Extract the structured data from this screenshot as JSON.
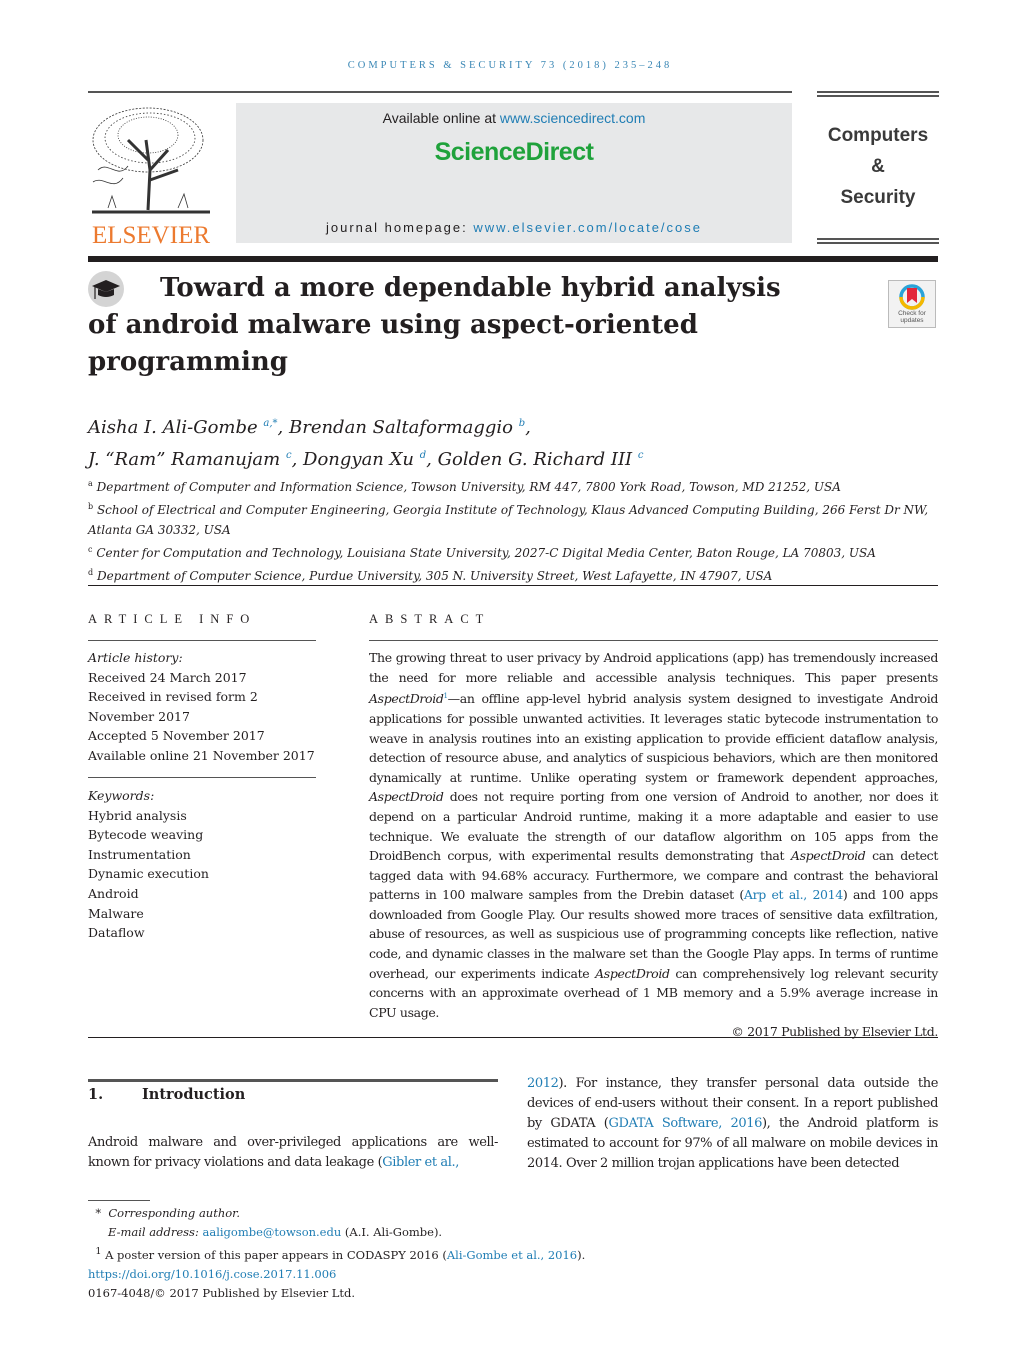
{
  "journal_ref": "COMPUTERS & SECURITY 73 (2018) 235–248",
  "header": {
    "publisher": "ELSEVIER",
    "available_online_prefix": "Available online at ",
    "available_online_link": "www.sciencedirect.com",
    "sciencedirect_logo": "ScienceDirect",
    "homepage_prefix": "journal homepage: ",
    "homepage_link": "www.elsevier.com/locate/cose",
    "journal_title_lines": [
      "Computers",
      "&",
      "Security"
    ],
    "check_updates": [
      "Check for",
      "updates"
    ],
    "title_icon": "graduation-cap-icon"
  },
  "title": {
    "line1": "Toward a more dependable hybrid analysis",
    "line2": "of android malware using aspect-oriented",
    "line3": "programming"
  },
  "authors": [
    {
      "name": "Aisha I. Ali-Gombe",
      "sup": "a,*",
      "sep": ", "
    },
    {
      "name": "Brendan Saltaformaggio",
      "sup": "b",
      "sep": ","
    },
    {
      "name": "J. “Ram” Ramanujam",
      "sup": "c",
      "sep": ", "
    },
    {
      "name": "Dongyan Xu",
      "sup": "d",
      "sep": ", "
    },
    {
      "name": "Golden G. Richard III",
      "sup": "c",
      "sep": ""
    }
  ],
  "affiliations": [
    {
      "key": "a",
      "text": "Department of Computer and Information Science, Towson University, RM 447, 7800 York Road, Towson, MD 21252, USA"
    },
    {
      "key": "b",
      "text": "School of Electrical and Computer Engineering, Georgia Institute of Technology, Klaus Advanced Computing Building, 266 Ferst Dr NW,"
    },
    {
      "key": "",
      "text": "Atlanta GA 30332, USA"
    },
    {
      "key": "c",
      "text": "Center for Computation and Technology, Louisiana State University, 2027-C Digital Media Center, Baton Rouge, LA 70803, USA"
    },
    {
      "key": "d",
      "text": "Department of Computer Science, Purdue University, 305 N. University Street, West Lafayette, IN 47907, USA"
    }
  ],
  "article_info": {
    "label": "ARTICLE INFO",
    "history_label": "Article history:",
    "history": [
      "Received 24 March 2017",
      "Received in revised form 2",
      "November 2017",
      "Accepted 5 November 2017",
      "Available online 21 November 2017"
    ],
    "keywords_label": "Keywords:",
    "keywords": [
      "Hybrid analysis",
      "Bytecode weaving",
      "Instrumentation",
      "Dynamic execution",
      "Android",
      "Malware",
      "Dataflow"
    ]
  },
  "abstract": {
    "label": "ABSTRACT",
    "p1": "The growing threat to user privacy by Android applications (app) has tremendously increased the need for more reliable and accessible analysis techniques. This paper presents ",
    "name1": "AspectDroid",
    "fn_mark": "1",
    "p2": "—an offline app-level hybrid analysis system designed to investigate Android applications for possible unwanted activities. It leverages static bytecode instrumentation to weave in analysis routines into an existing application to provide efficient dataflow analysis, detection of resource abuse, and analytics of suspicious behaviors, which are then monitored dynamically at runtime. Unlike operating system or framework dependent approaches, ",
    "name2": "AspectDroid",
    "p3": " does not require porting from one version of Android to another, nor does it depend on a particular Android runtime, making it a more adaptable and easier to use technique. We evaluate the strength of our dataflow algorithm on 105 apps from the DroidBench corpus, with experimental results demonstrating that ",
    "name3": "AspectDroid",
    "p4": " can detect tagged data with 94.68% accuracy. Furthermore, we compare and contrast the behavioral patterns in 100 malware samples from the Drebin dataset (",
    "cite1": "Arp et al., 2014",
    "p5": ") and 100 apps downloaded from Google Play. Our results showed more traces of sensitive data exfiltration, abuse of resources, as well as suspicious use of programming concepts like reflection, native code, and dynamic classes in the malware set than the Google Play apps. In terms of runtime overhead, our experiments indicate ",
    "name4": "AspectDroid",
    "p6": " can comprehensively log relevant security concerns with an approximate overhead of 1 MB memory and a 5.9% average increase in CPU usage.",
    "copyright": "© 2017 Published by Elsevier Ltd."
  },
  "introduction": {
    "number": "1.",
    "heading": "Introduction",
    "left_text": "Android malware and over-privileged applications are well-known for privacy violations and data leakage (",
    "left_cite": "Gibler et al.,",
    "right_cite_start": "2012",
    "right_text1": "). For instance, they transfer personal data outside the devices of end-users without their consent. In a report published by GDATA (",
    "right_cite2": "GDATA Software, 2016",
    "right_text2": "), the Android platform is estimated to account for 97% of all malware on mobile devices in 2014. Over 2 million trojan applications have been detected"
  },
  "footnotes": {
    "star_mark": "*",
    "corresponding": "Corresponding author.",
    "email_label": "E-mail address: ",
    "email": "aaligombe@towson.edu",
    "email_suffix": " (A.I. Ali-Gombe).",
    "fn1_mark": "1",
    "fn1_text": "A poster version of this paper appears in CODASPY 2016 (",
    "fn1_cite": "Ali-Gombe et al., 2016",
    "fn1_end": ").",
    "doi": "https://doi.org/10.1016/j.cose.2017.11.006",
    "issn": "0167-4048/© 2017 Published by Elsevier Ltd."
  }
}
